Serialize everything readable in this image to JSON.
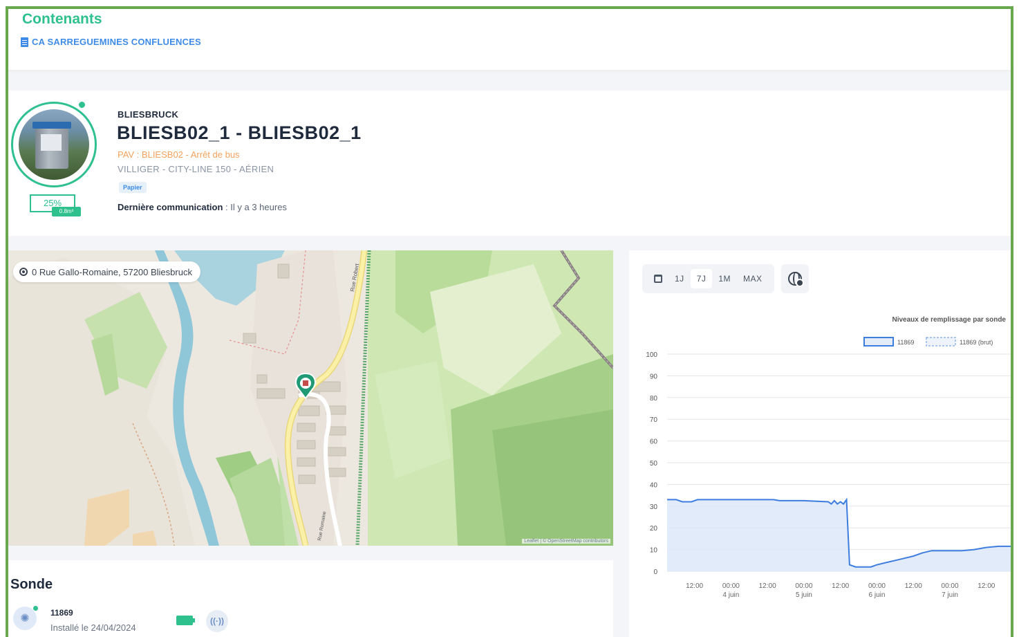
{
  "header": {
    "title": "Contenants",
    "organization": "CA SARREGUEMINES CONFLUENCES"
  },
  "container": {
    "city": "BLIESBRUCK",
    "title": "BLIESB02_1 - BLIESB02_1",
    "pav_line": "PAV : BLIESB02 - Arrêt de bus",
    "model_line": "VILLIGER - CITY-LINE 150 - AÉRIEN",
    "waste_type": "Papier",
    "fill_level": "25%",
    "fill_badge": "0.8m³",
    "last_comm_label": "Dernière communication",
    "last_comm_value": " : Il y a 3 heures"
  },
  "map": {
    "address": "0 Rue Gallo-Romaine, 57200 Bliesbruck",
    "attribution": "Leaflet | © OpenStreetMap contributors",
    "street_labels": [
      "Rue Robert",
      "Rue Romaine"
    ]
  },
  "sonde": {
    "title": "Sonde",
    "id": "11869",
    "installed": "Installé le 24/04/2024"
  },
  "toolbar": {
    "ranges": [
      "1J",
      "7J",
      "1M",
      "MAX"
    ],
    "active_range": "7J"
  },
  "colors": {
    "brand_green": "#2ec08d",
    "accent_blue": "#3d8be6",
    "series_blue": "#3d7de0",
    "frame_green": "#6aa84f"
  },
  "chart_data": {
    "type": "area",
    "title": "Niveaux de remplissage par sonde",
    "legend": [
      {
        "name": "11869",
        "style": "solid"
      },
      {
        "name": "11869 (brut)",
        "style": "dashed"
      }
    ],
    "legend_position": "top-right",
    "ylim": [
      0,
      100
    ],
    "y_ticks": [
      0,
      10,
      20,
      30,
      40,
      50,
      60,
      70,
      80,
      90,
      100
    ],
    "x_ticks": [
      {
        "t": 12,
        "label": "12:00",
        "sub": ""
      },
      {
        "t": 24,
        "label": "00:00",
        "sub": "4 juin"
      },
      {
        "t": 36,
        "label": "12:00",
        "sub": ""
      },
      {
        "t": 48,
        "label": "00:00",
        "sub": "5 juin"
      },
      {
        "t": 60,
        "label": "12:00",
        "sub": ""
      },
      {
        "t": 72,
        "label": "00:00",
        "sub": "6 juin"
      },
      {
        "t": 84,
        "label": "12:00",
        "sub": ""
      },
      {
        "t": 96,
        "label": "00:00",
        "sub": "7 juin"
      },
      {
        "t": 108,
        "label": "12:00",
        "sub": ""
      }
    ],
    "x_range": [
      3,
      116
    ],
    "grid": true,
    "series": [
      {
        "name": "11869",
        "points": [
          [
            3,
            33
          ],
          [
            6,
            33
          ],
          [
            8,
            32
          ],
          [
            11,
            32
          ],
          [
            13,
            33
          ],
          [
            20,
            33
          ],
          [
            30,
            33
          ],
          [
            38,
            33
          ],
          [
            40,
            32.5
          ],
          [
            48,
            32.5
          ],
          [
            56,
            32
          ],
          [
            57,
            31
          ],
          [
            58,
            32.5
          ],
          [
            59,
            31
          ],
          [
            60,
            32
          ],
          [
            61,
            31
          ],
          [
            62,
            33
          ],
          [
            63,
            3
          ],
          [
            65,
            2
          ],
          [
            67,
            2
          ],
          [
            70,
            2
          ],
          [
            72,
            3
          ],
          [
            75,
            4
          ],
          [
            78,
            5
          ],
          [
            81,
            6
          ],
          [
            84,
            7
          ],
          [
            87,
            8.5
          ],
          [
            90,
            9.5
          ],
          [
            95,
            9.5
          ],
          [
            100,
            9.5
          ],
          [
            104,
            10
          ],
          [
            108,
            11
          ],
          [
            112,
            11.5
          ],
          [
            116,
            11.5
          ]
        ]
      }
    ]
  }
}
